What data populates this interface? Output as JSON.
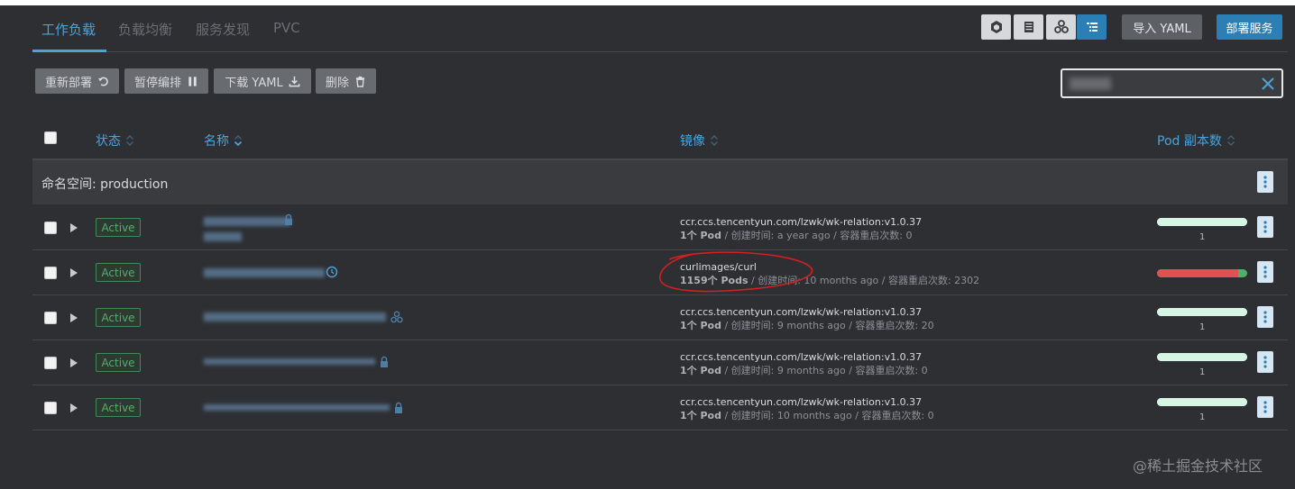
{
  "tabs": [
    {
      "label": "工作负载",
      "active": true
    },
    {
      "label": "负载均衡",
      "active": false
    },
    {
      "label": "服务发现",
      "active": false
    },
    {
      "label": "PVC",
      "active": false
    }
  ],
  "header": {
    "import_label": "导入 YAML",
    "deploy_label": "部署服务",
    "view_icons": [
      "cube-icon",
      "list-icon",
      "nodes-icon",
      "tree-list-icon"
    ]
  },
  "actions": {
    "redeploy_label": "重新部署",
    "pause_label": "暂停编排",
    "download_label": "下载 YAML",
    "delete_label": "删除"
  },
  "table": {
    "columns": {
      "status": "状态",
      "name": "名称",
      "image": "镜像",
      "pods": "Pod 副本数"
    },
    "group_label": "命名空间: production",
    "rows": [
      {
        "status": "Active",
        "image": "ccr.ccs.tencentyun.com/lzwk/wk-relation:v1.0.37",
        "pods_text": "1个 Pod",
        "meta": " / 创建时间: a year ago / 容器重启次数: 0",
        "pod_count": "1",
        "pod_ratio": 1.0,
        "bar_color": "#d6f5e3"
      },
      {
        "status": "Active",
        "image": "curlimages/curl",
        "pods_text": "1159个 Pods",
        "meta": " / 创建时间: 10 months ago / 容器重启次数: 2302",
        "pod_count": "",
        "pod_ratio": 0.9,
        "bar_color": "#e05252"
      },
      {
        "status": "Active",
        "image": "ccr.ccs.tencentyun.com/lzwk/wk-relation:v1.0.37",
        "pods_text": "1个 Pod",
        "meta": " / 创建时间: 9 months ago / 容器重启次数: 20",
        "pod_count": "1",
        "pod_ratio": 1.0,
        "bar_color": "#d6f5e3"
      },
      {
        "status": "Active",
        "image": "ccr.ccs.tencentyun.com/lzwk/wk-relation:v1.0.37",
        "pods_text": "1个 Pod",
        "meta": " / 创建时间: 9 months ago / 容器重启次数: 0",
        "pod_count": "1",
        "pod_ratio": 1.0,
        "bar_color": "#d6f5e3"
      },
      {
        "status": "Active",
        "image": "ccr.ccs.tencentyun.com/lzwk/wk-relation:v1.0.37",
        "pods_text": "1个 Pod",
        "meta": " / 创建时间: 10 months ago / 容器重启次数: 0",
        "pod_count": "1",
        "pod_ratio": 1.0,
        "bar_color": "#d6f5e3"
      }
    ]
  },
  "watermark": "@稀土掘金技术社区"
}
